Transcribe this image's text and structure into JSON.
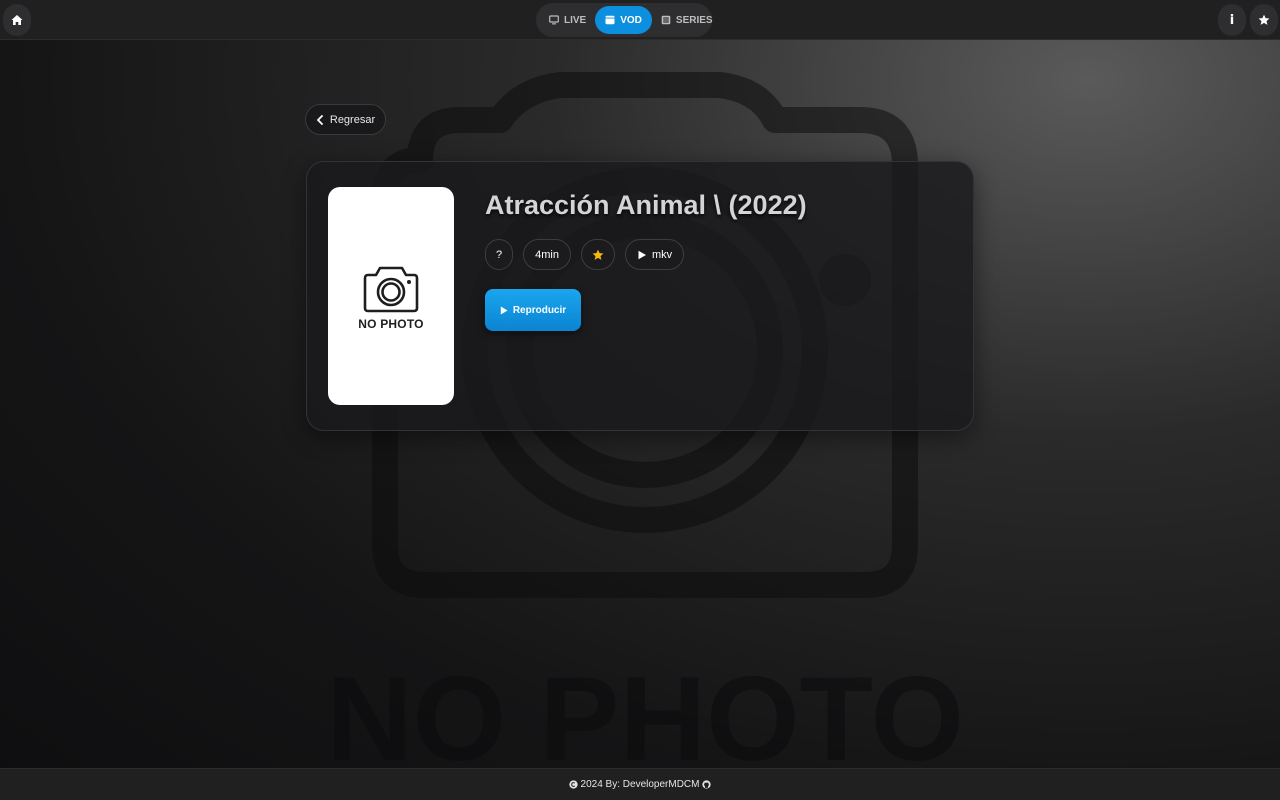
{
  "background": {
    "watermark_text": "NO PHOTO"
  },
  "topbar": {
    "home_icon": "home-icon",
    "tabs": [
      {
        "label": "LIVE",
        "icon": "tv-icon",
        "active": false
      },
      {
        "label": "VOD",
        "icon": "film-icon",
        "active": true
      },
      {
        "label": "SERIES",
        "icon": "series-icon",
        "active": false
      }
    ],
    "info_label": "i",
    "favorites_icon": "star-icon",
    "active_color": "#0d8fe0"
  },
  "detail": {
    "back_label": "Regresar",
    "poster_text": "NO PHOTO",
    "title": "Atracción Animal \\ (2022)",
    "rating": "?",
    "duration": "4min",
    "favorite_icon": "star-icon",
    "format": "mkv",
    "play_label": "Reproducir"
  },
  "footer": {
    "text": "2024 By: DeveloperMDCM"
  }
}
